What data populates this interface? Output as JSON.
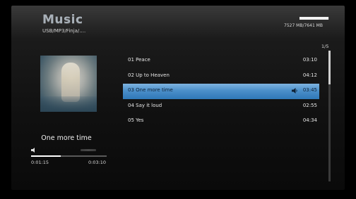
{
  "header": {
    "title": "Music",
    "breadcrumb": "USB/MP3/Finja/....",
    "storage_text": "7527 MB/7641 MB",
    "storage_used_fraction": 0.985
  },
  "list": {
    "page_indicator": "1/5",
    "tracks": [
      {
        "name": "01 Peace",
        "duration": "03:10"
      },
      {
        "name": "02 Up to Heaven",
        "duration": "04:12"
      },
      {
        "name": "03 One more time",
        "duration": "03:45"
      },
      {
        "name": "04 Say it loud",
        "duration": "02:55"
      },
      {
        "name": "05 Yes",
        "duration": "04:34"
      }
    ],
    "selected_index": 2,
    "scroll_position_fraction": 0.0
  },
  "player": {
    "now_playing_title": "One more time",
    "elapsed": "0:01:15",
    "total": "0:03:10",
    "progress_fraction": 0.39,
    "status_icon": "speaker-icon"
  },
  "colors": {
    "selection": "#4b8fca",
    "background": "#101010",
    "text": "#e6e6e6"
  }
}
